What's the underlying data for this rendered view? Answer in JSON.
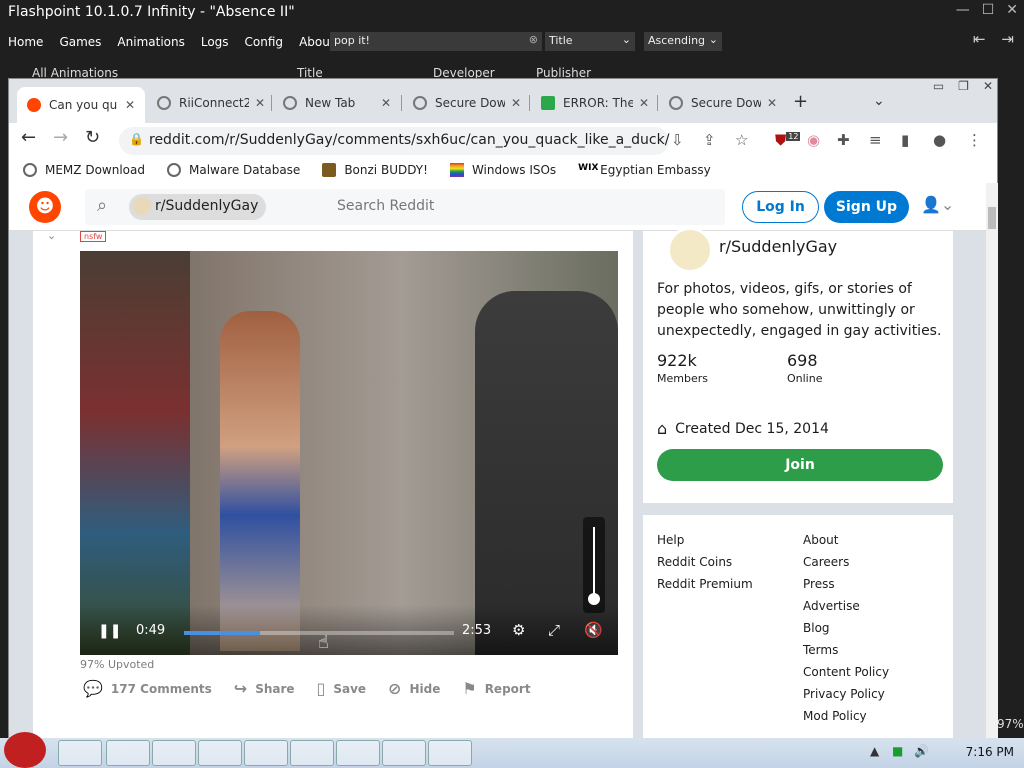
{
  "launcher": {
    "title": "Flashpoint 10.1.0.7 Infinity - \"Absence II\"",
    "menu": [
      "Home",
      "Games",
      "Animations",
      "Logs",
      "Config",
      "About"
    ],
    "search_value": "pop it!",
    "sort_field": "Title",
    "sort_order": "Ascending",
    "columns": [
      "All Animations",
      "Title",
      "Developer",
      "Publisher"
    ],
    "zoom_fragment": "97%"
  },
  "browser": {
    "tabs": [
      {
        "label": "Can you qu",
        "icon_color": "#ff4500",
        "active": true
      },
      {
        "label": "RiiConnect2",
        "icon_color": "#777",
        "active": false
      },
      {
        "label": "New Tab",
        "icon_color": "#777",
        "active": false
      },
      {
        "label": "Secure Dow",
        "icon_color": "#777",
        "active": false
      },
      {
        "label": "ERROR: The",
        "icon_color": "#2aa84a",
        "active": false
      },
      {
        "label": "Secure Dow",
        "icon_color": "#777",
        "active": false
      }
    ],
    "url": "reddit.com/r/SuddenlyGay/comments/sxh6uc/can_you_quack_like_a_duck/",
    "ext_badge": "12",
    "bookmarks": [
      {
        "label": "MEMZ Download",
        "color": "#666"
      },
      {
        "label": "Malware Database",
        "color": "#666"
      },
      {
        "label": "Bonzi BUDDY!",
        "color": "#7a5c20"
      },
      {
        "label": "Windows ISOs",
        "color": "#e03030"
      },
      {
        "label": "Egyptian Embassy",
        "color": "#000"
      }
    ]
  },
  "reddit": {
    "subreddit_chip": "r/SuddenlyGay",
    "search_placeholder": "Search Reddit",
    "login": "Log In",
    "signup": "Sign Up",
    "post": {
      "tag": "nsfw",
      "video_current": "0:49",
      "video_total": "2:53",
      "progress": 0.28,
      "upvoted": "97% Upvoted",
      "actions": [
        {
          "label": "177 Comments",
          "icon": "comment-icon"
        },
        {
          "label": "Share",
          "icon": "share-icon"
        },
        {
          "label": "Save",
          "icon": "bookmark-icon"
        },
        {
          "label": "Hide",
          "icon": "hide-icon"
        },
        {
          "label": "Report",
          "icon": "flag-icon"
        }
      ]
    },
    "sidebar": {
      "name": "r/SuddenlyGay",
      "description": "For photos, videos, gifs, or stories of people who somehow, unwittingly or unexpectedly, engaged in gay activities.",
      "members_value": "922k",
      "members_label": "Members",
      "online_value": "698",
      "online_label": "Online",
      "created": "Created Dec 15, 2014",
      "join": "Join"
    },
    "links_left": [
      "Help",
      "Reddit Coins",
      "Reddit Premium"
    ],
    "links_right": [
      "About",
      "Careers",
      "Press",
      "Advertise",
      "Blog",
      "Terms",
      "Content Policy",
      "Privacy Policy",
      "Mod Policy"
    ]
  },
  "taskbar": {
    "clock": "7:16 PM"
  }
}
